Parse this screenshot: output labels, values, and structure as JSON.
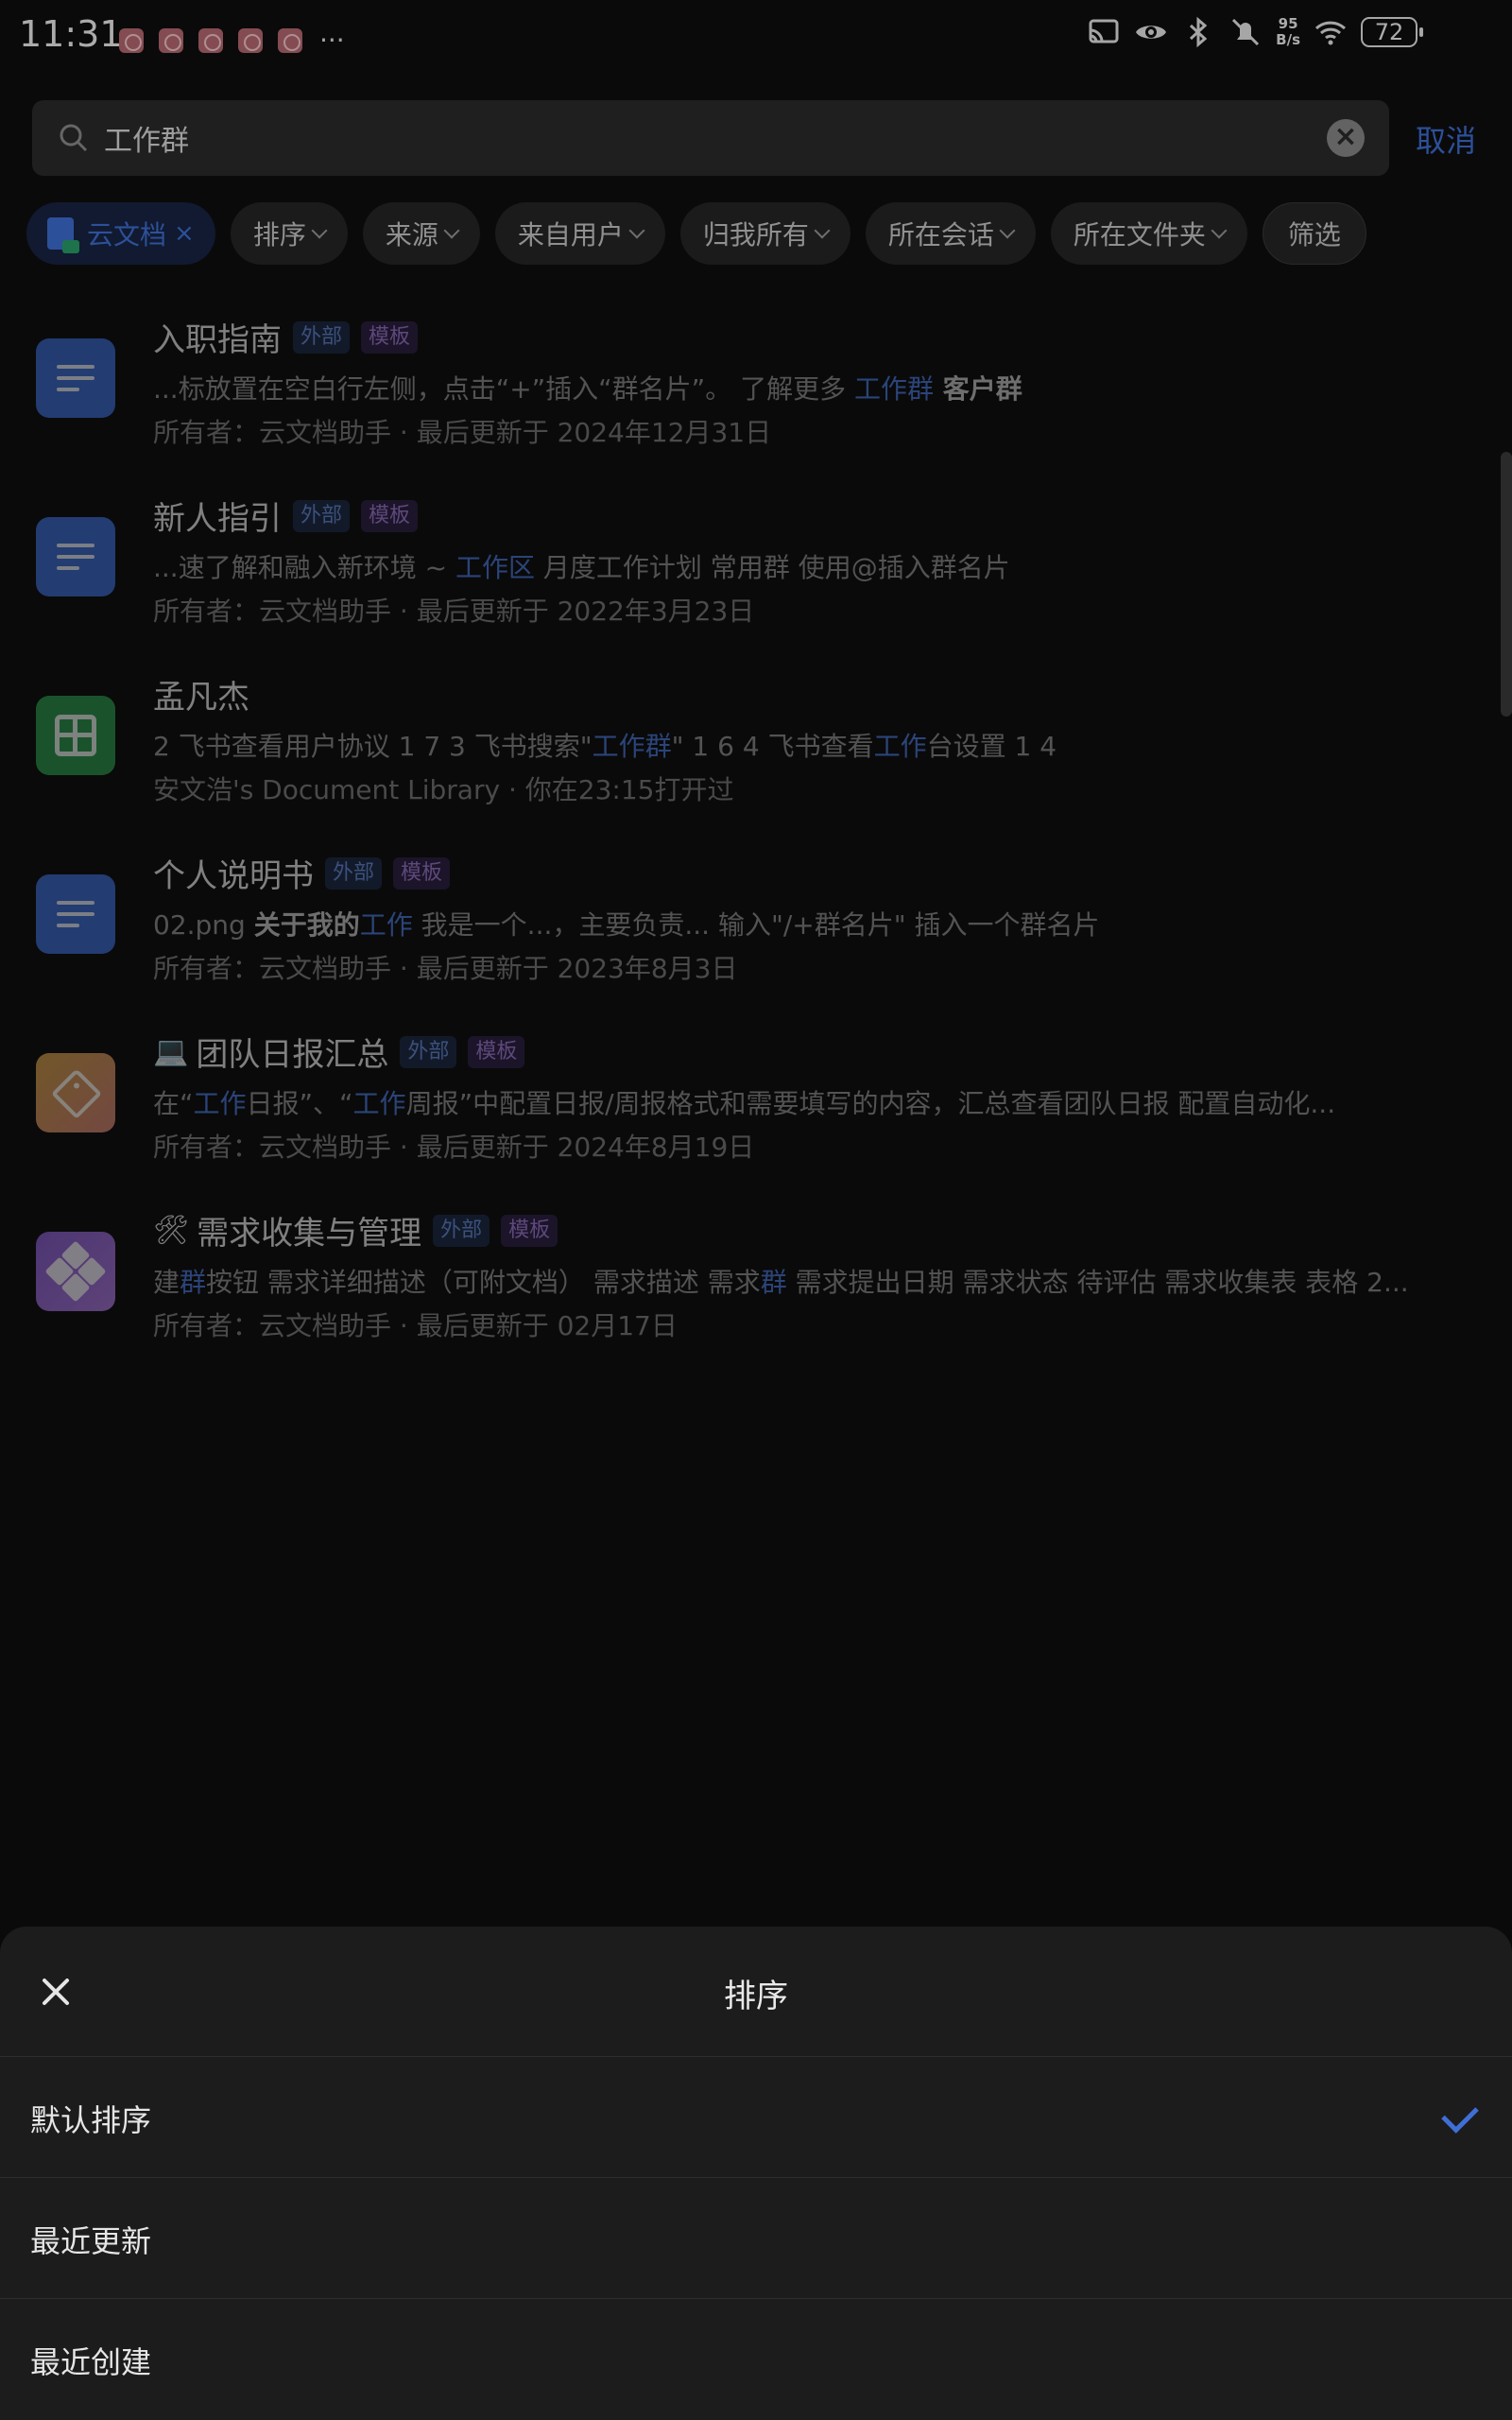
{
  "status_bar": {
    "time": "11:31",
    "more": "···",
    "net_speed_top": "95",
    "net_speed_bottom": "B/s",
    "battery": "72"
  },
  "search": {
    "value": "工作群",
    "cancel_label": "取消"
  },
  "filters": {
    "active_label": "云文档",
    "active_close": "×",
    "sort": "排序",
    "source": "来源",
    "from_user": "来自用户",
    "owned_by_me": "归我所有",
    "in_chat": "所在会话",
    "in_folder": "所在文件夹",
    "filter": "筛选"
  },
  "results": [
    {
      "title": "入职指南",
      "badge_ext": "外部",
      "badge_tpl": "模板",
      "snippet_pre": "...标放置在空白行左侧，点击“+”插入“群名片”。  了解更多  ",
      "snippet_hl": "工作群",
      "snippet_bold": "  客户群",
      "meta": "所有者：云文档助手 · 最后更新于 2024年12月31日"
    },
    {
      "title": "新人指引",
      "badge_ext": "外部",
      "badge_tpl": "模板",
      "snippet_pre": "...速了解和融入新环境 ~  ",
      "snippet_hl": "工作",
      "snippet_bold": "区",
      "snippet_post": "   月度工作计划   常用群   使用@插入群名片",
      "meta": "所有者：云文档助手 · 最后更新于 2022年3月23日"
    },
    {
      "title": "孟凡杰",
      "snippet_pre": "2 飞书查看用户协议 1 7   3 飞书搜索\"",
      "snippet_hl": "工作群",
      "snippet_mid": "\" 1 6   4 飞书查看",
      "snippet_hl2": "工作",
      "snippet_post": "台设置 1 4",
      "meta": "安文浩's Document Library · 你在23:15打开过"
    },
    {
      "title": "个人说明书",
      "badge_ext": "外部",
      "badge_tpl": "模板",
      "snippet_pre": "02.png  ",
      "snippet_bold": "关于我的",
      "snippet_hl": "工作",
      "snippet_post": "   我是一个...，主要负责...   输入\"/+群名片\" 插入一个群名片",
      "meta": "所有者：云文档助手 · 最后更新于 2023年8月3日"
    },
    {
      "title": "团队日报汇总",
      "badge_ext": "外部",
      "badge_tpl": "模板",
      "snippet_pre": "在“",
      "snippet_hl": "工作",
      "snippet_mid": "日报”、“",
      "snippet_hl2": "工作",
      "snippet_post": "周报”中配置日报/周报格式和需要填写的内容，汇总查看团队日报  配置自动化...",
      "meta": "所有者：云文档助手 · 最后更新于 2024年8月19日"
    },
    {
      "title": "需求收集与管理",
      "badge_ext": "外部",
      "badge_tpl": "模板",
      "snippet_pre": "建",
      "snippet_hl": "群",
      "snippet_mid": "按钮 需求详细描述（可附文档） 需求描述 需求",
      "snippet_hl2": "群",
      "snippet_post": " 需求提出日期 需求状态 待评估  需求收集表 表格 2...",
      "meta": "所有者：云文档助手 · 最后更新于 02月17日"
    }
  ],
  "sort_sheet": {
    "title": "排序",
    "options": [
      "默认排序",
      "最近更新",
      "最近创建"
    ],
    "selected_index": 0
  },
  "colors": {
    "accent": "#3f6fd6",
    "background": "#0e0e0e",
    "sheet": "#1c1c1c"
  }
}
